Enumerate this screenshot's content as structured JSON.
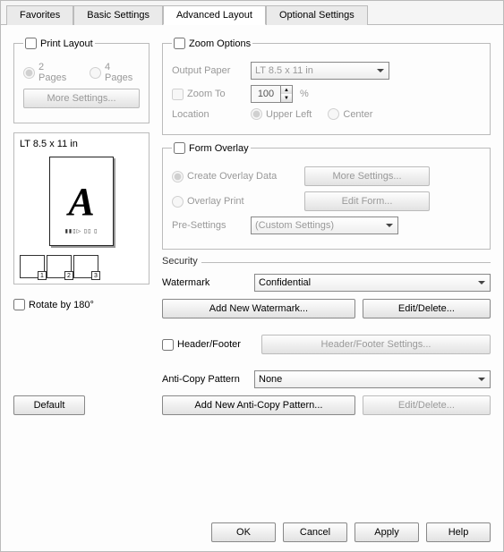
{
  "tabs": {
    "favorites": "Favorites",
    "basic": "Basic Settings",
    "advanced": "Advanced Layout",
    "optional": "Optional Settings"
  },
  "printLayout": {
    "legend": "Print Layout",
    "opt2": "2 Pages",
    "opt4": "4 Pages",
    "moreSettings": "More Settings..."
  },
  "preview": {
    "paper": "LT 8.5 x 11 in",
    "thumb1": "1",
    "thumb2": "2",
    "thumb3": "3"
  },
  "rotate": "Rotate by 180°",
  "defaultBtn": "Default",
  "zoom": {
    "legend": "Zoom Options",
    "outputPaper": "Output Paper",
    "outputValue": "LT 8.5 x 11 in",
    "zoomTo": "Zoom To",
    "zoomValue": "100",
    "pct": "%",
    "location": "Location",
    "upperLeft": "Upper Left",
    "center": "Center"
  },
  "overlay": {
    "legend": "Form Overlay",
    "create": "Create Overlay Data",
    "moreSettings": "More Settings...",
    "overlayPrint": "Overlay Print",
    "editForm": "Edit Form...",
    "preSettings": "Pre-Settings",
    "preValue": "(Custom Settings)"
  },
  "security": {
    "legend": "Security",
    "watermark": "Watermark",
    "watermarkValue": "Confidential",
    "addWatermark": "Add New Watermark...",
    "editDelete": "Edit/Delete...",
    "headerFooter": "Header/Footer",
    "hfSettings": "Header/Footer Settings...",
    "antiCopy": "Anti-Copy Pattern",
    "antiCopyValue": "None",
    "addAntiCopy": "Add New Anti-Copy Pattern...",
    "editDelete2": "Edit/Delete..."
  },
  "footer": {
    "ok": "OK",
    "cancel": "Cancel",
    "apply": "Apply",
    "help": "Help"
  }
}
